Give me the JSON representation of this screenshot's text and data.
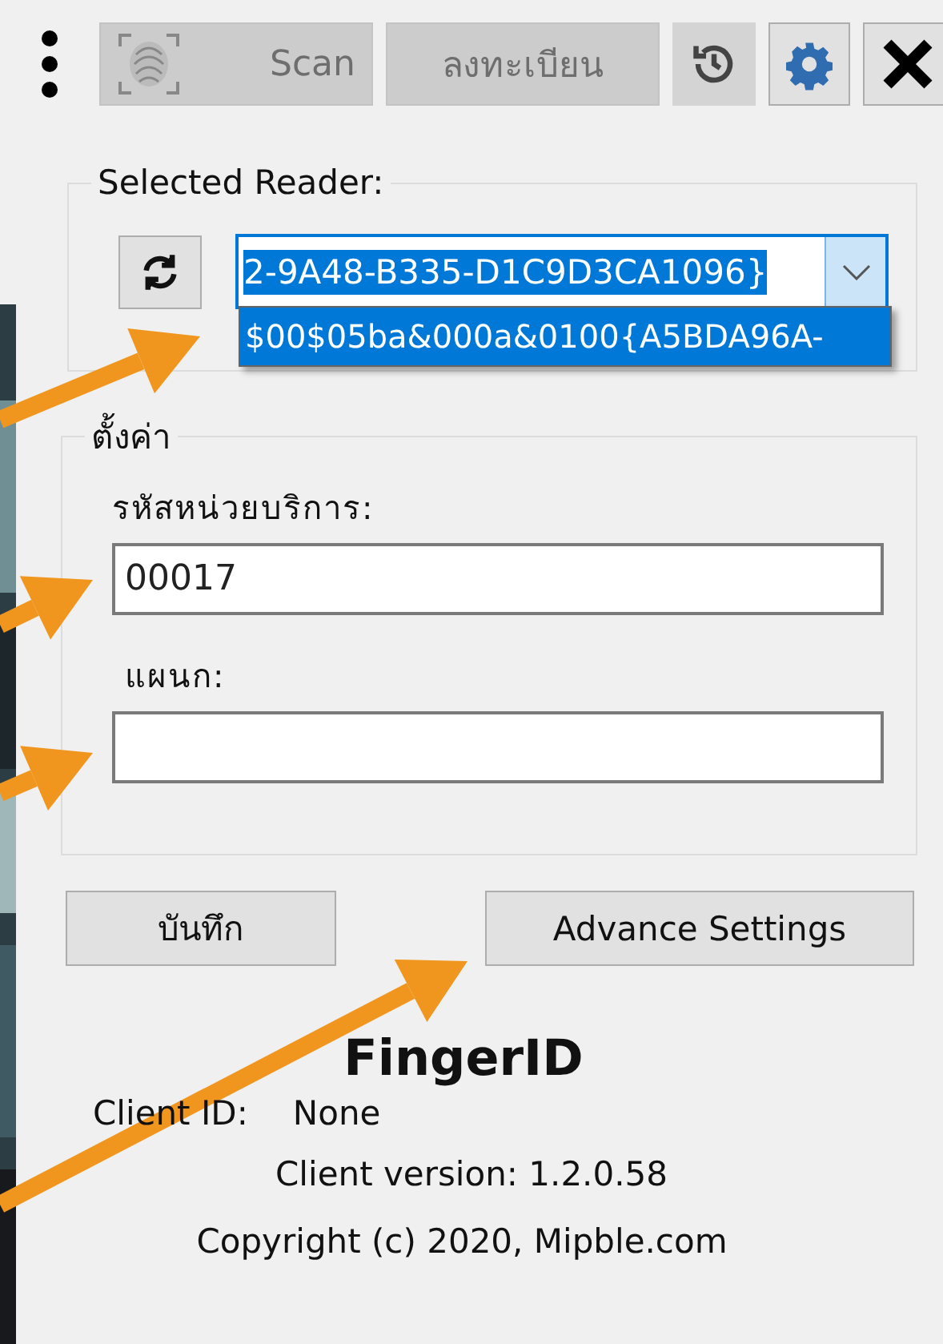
{
  "toolbar": {
    "buttons": [
      {
        "kind": "scan",
        "label": "Scan",
        "disabled": true
      },
      {
        "kind": "register",
        "label": "ลงทะเบียน",
        "disabled": true
      },
      {
        "kind": "history",
        "disabled": false
      },
      {
        "kind": "settings",
        "disabled": false
      },
      {
        "kind": "close",
        "disabled": false
      }
    ]
  },
  "reader_group": {
    "title": "Selected Reader:",
    "combo": {
      "value": "2-9A48-B335-D1C9D3CA1096}",
      "value_highlighted": true,
      "expanded": true,
      "options": [
        {
          "label": "$00$05ba&000a&0100{A5BDA96A-",
          "selected": true
        }
      ]
    }
  },
  "settings_group": {
    "title": "ตั้งค่า",
    "fields": [
      {
        "label": "รหัสหน่วยบริการ:",
        "value": "00017"
      },
      {
        "label": "แผนก:"
      }
    ]
  },
  "buttons": [
    "บันทึก",
    "Advance Settings"
  ],
  "about": {
    "app_name": "FingerID",
    "client_id_label": "Client ID:",
    "client_id": "None",
    "version": "Client version: 1.2.0.58",
    "copyright": "Copyright (c) 2020, Mipble.com"
  }
}
